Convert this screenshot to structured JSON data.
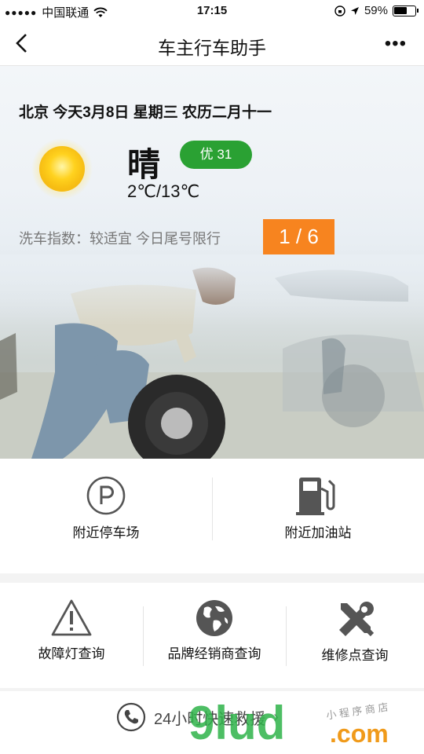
{
  "status_bar": {
    "carrier": "中国联通",
    "time": "17:15",
    "battery": "59%"
  },
  "nav": {
    "title": "车主行车助手",
    "more": "•••"
  },
  "weather": {
    "date_line": "北京 今天3月8日 星期三 农历二月十一",
    "condition": "晴",
    "aqi": "优 31",
    "temperature": "2℃/13℃",
    "wash_index": "洗车指数：较适宜 今日尾号限行",
    "plate_limit": "1 / 6"
  },
  "services_row1": [
    {
      "label": "附近停车场",
      "icon": "parking-icon"
    },
    {
      "label": "附近加油站",
      "icon": "gas-station-icon"
    }
  ],
  "services_row2": [
    {
      "label": "故障灯查询",
      "icon": "warning-icon"
    },
    {
      "label": "品牌经销商查询",
      "icon": "globe-icon"
    },
    {
      "label": "维修点查询",
      "icon": "tools-icon"
    }
  ],
  "footer": {
    "rescue_label": "24小时快速救援",
    "chevron": "›"
  },
  "watermark": {
    "main": "9lud",
    "domain": ".com",
    "note": "小 程 序 商 店"
  },
  "colors": {
    "aqi_green": "#2aa133",
    "limit_orange": "#f7841f"
  }
}
